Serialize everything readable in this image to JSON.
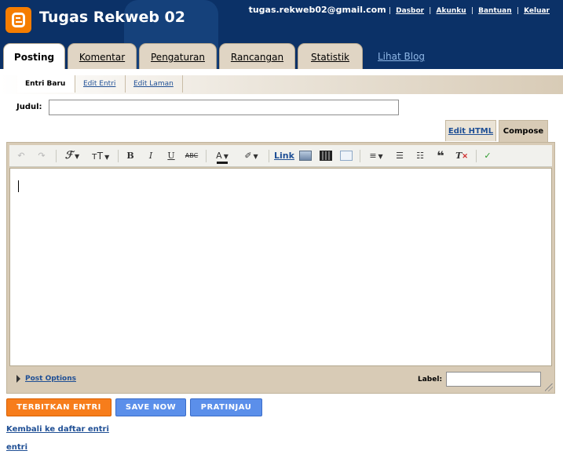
{
  "header": {
    "blog_title": "Tugas Rekweb 02",
    "email": "tugas.rekweb02@gmail.com",
    "links": [
      "Dasbor",
      "Akunku",
      "Bantuan",
      "Keluar"
    ],
    "sep": "|"
  },
  "tabs": [
    "Posting",
    "Komentar",
    "Pengaturan",
    "Rancangan",
    "Statistik"
  ],
  "view_blog": "Lihat Blog",
  "subtabs": [
    "Entri Baru",
    "Edit Entri",
    "Edit Laman"
  ],
  "form": {
    "title_label": "Judul:",
    "title_value": "",
    "mode_edit_html": "Edit HTML",
    "mode_compose": "Compose",
    "label_label": "Label:",
    "label_value": "",
    "post_options": "Post Options"
  },
  "toolbar": {
    "link": "Link",
    "icons": [
      "undo-icon",
      "redo-icon",
      "font-icon",
      "font-size-icon",
      "bold-icon",
      "italic-icon",
      "underline-icon",
      "strikethrough-icon",
      "text-color-icon",
      "highlight-icon",
      "image-icon",
      "video-icon",
      "jump-break-icon",
      "align-icon",
      "numbered-list-icon",
      "bullet-list-icon",
      "blockquote-icon",
      "remove-format-icon",
      "spellcheck-icon"
    ]
  },
  "buttons": {
    "publish": "TERBITKAN ENTRI",
    "save": "SAVE NOW",
    "preview": "PRATINJAU"
  },
  "footer": {
    "back": "Kembali ke daftar entri",
    "entri": "entri"
  },
  "colors": {
    "header_bg": "#0b3167",
    "logo": "#f57d00",
    "publish_button": "#f77d1b",
    "blue_button": "#5b8fea",
    "text_color_bar": "#1a1a1a"
  }
}
